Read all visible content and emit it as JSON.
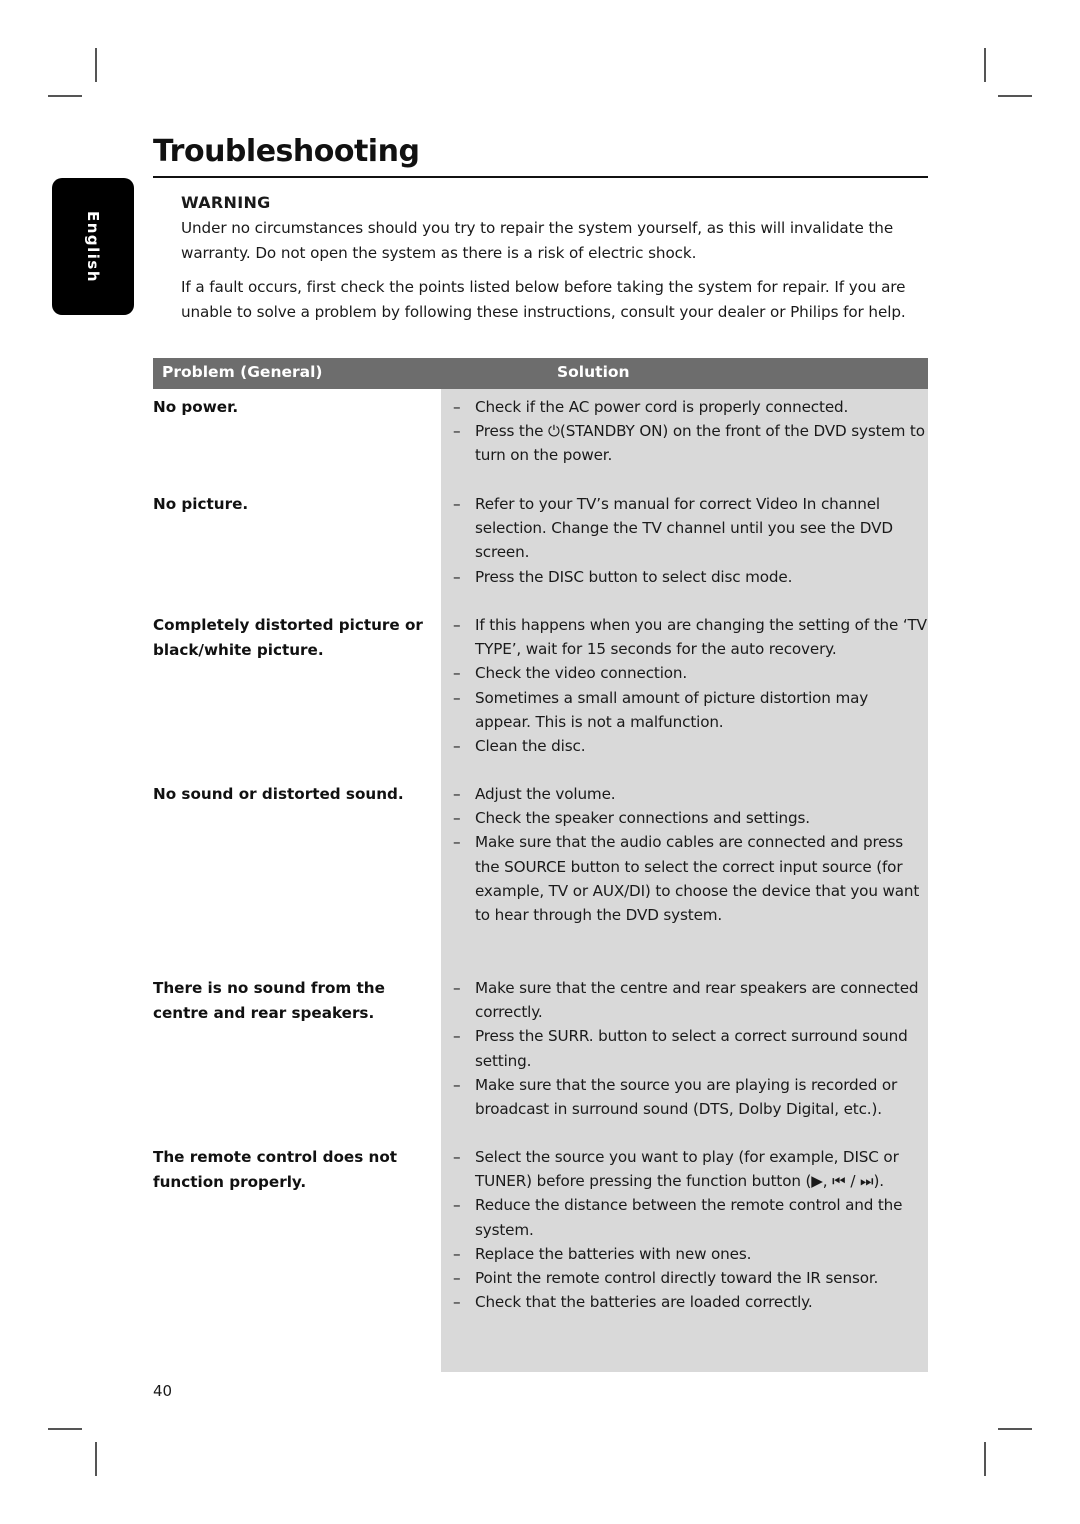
{
  "page": {
    "title": "Troubleshooting",
    "language_tab": "English",
    "page_number": "40"
  },
  "warning": {
    "heading": "WARNING",
    "text": "Under no circumstances should you try to repair the system yourself, as this will invalidate the warranty. Do not open the system as there is a risk of electric shock."
  },
  "intro": "If a fault occurs, first check the points listed below before taking the system for repair. If you are unable to solve a problem by following these instructions, consult your dealer or Philips for help.",
  "table": {
    "header": {
      "problem": "Problem (General)",
      "solution": "Solution"
    },
    "colors": {
      "header_bg": "#6d6d6d",
      "solution_bg": "#d9d9d9"
    },
    "rows": [
      {
        "problem": "No power.",
        "solutions": [
          "Check if the AC power cord is properly connected.",
          "Press the ⏻(STANDBY ON) on the front of the DVD system to turn on the power."
        ]
      },
      {
        "problem": "No picture.",
        "solutions": [
          "Refer to your TV’s manual for correct Video In channel  selection. Change the TV channel until you see the DVD screen.",
          "Press the DISC button to select disc mode."
        ]
      },
      {
        "problem": "Completely distorted picture or black/white picture.",
        "solutions": [
          "If this happens when you are changing the setting of the ‘TV TYPE’, wait for 15 seconds for the auto recovery.",
          "Check the video connection.",
          "Sometimes a small amount of picture distortion may appear. This is not a malfunction.",
          "Clean the disc."
        ]
      },
      {
        "problem": "No sound or distorted sound.",
        "solutions": [
          "Adjust the volume.",
          "Check the speaker connections and settings.",
          "Make sure that the audio cables are connected and press the SOURCE button to select the correct input source (for example, TV or AUX/DI) to choose the device that you want to hear through the DVD system."
        ]
      },
      {
        "problem": "There is no sound from the centre and rear speakers.",
        "solutions": [
          "Make sure that the centre and rear speakers are connected correctly.",
          "Press the SURR. button to select a correct surround sound setting.",
          "Make sure that the source you are playing is recorded or broadcast in surround sound (DTS, Dolby Digital, etc.)."
        ]
      },
      {
        "problem": "The remote control does not function properly.",
        "solutions": [
          "Select the source you want to play (for example, DISC or TUNER) before pressing the function button (▶, ⏮ / ⏭).",
          "Reduce the distance between the remote control and the system.",
          "Replace the batteries with new ones.",
          "Point the remote control directly toward the IR sensor.",
          "Check that the batteries are loaded correctly."
        ]
      }
    ]
  }
}
